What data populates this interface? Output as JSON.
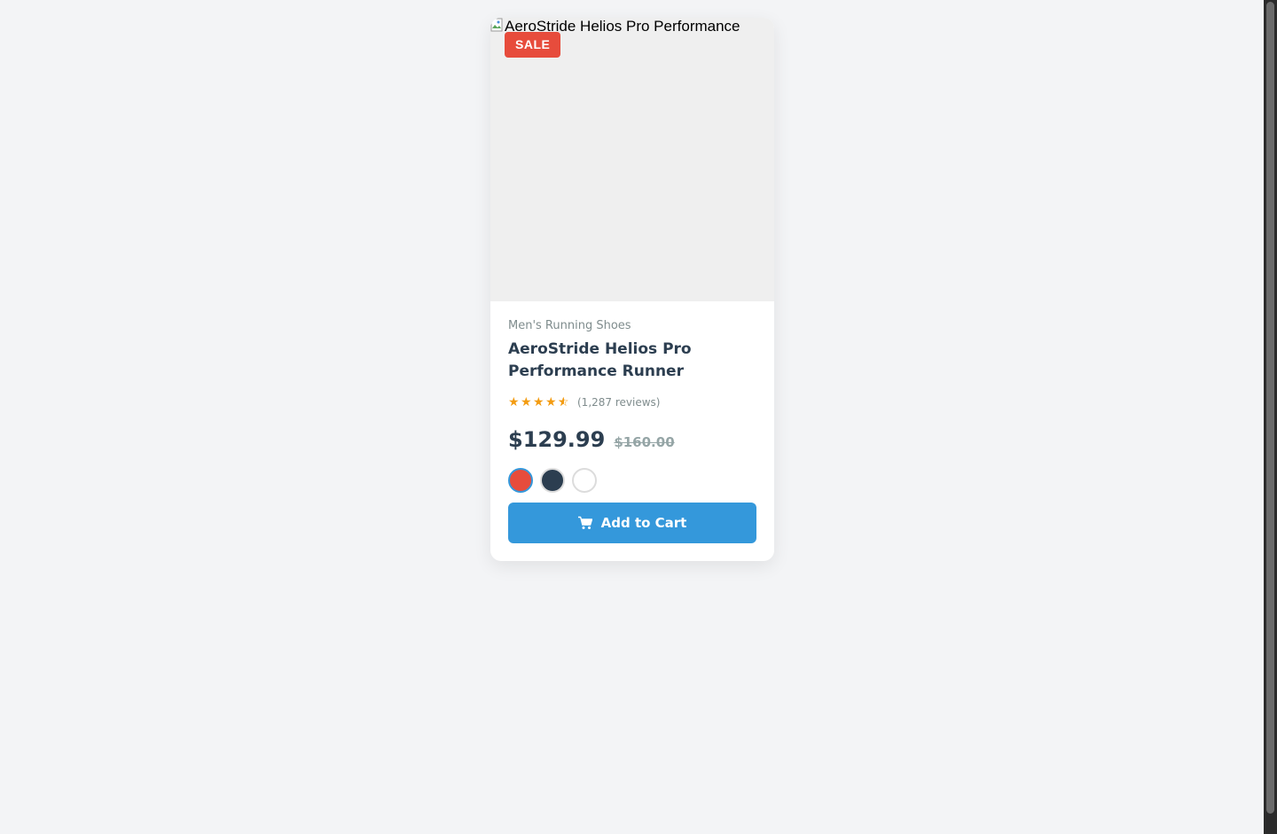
{
  "product": {
    "image_alt": "AeroStride Helios Pro Performance Runner",
    "badge": "SALE",
    "category": "Men's Running Shoes",
    "name": "AeroStride Helios Pro Performance Runner",
    "rating": 4.5,
    "rating_max": 5,
    "reviews": "(1,287 reviews)",
    "price": "$129.99",
    "old_price": "$160.00",
    "colors": [
      {
        "name": "red",
        "hex": "#e74c3c",
        "selected": true
      },
      {
        "name": "navy",
        "hex": "#2c3e50",
        "selected": false
      },
      {
        "name": "white",
        "hex": "#ffffff",
        "selected": false
      }
    ],
    "add_to_cart_label": "Add to Cart",
    "cart_icon": "cart-icon"
  },
  "colors": {
    "accent": "#3498db",
    "sale": "#e74c3c",
    "star": "#f39c12",
    "title": "#2c3e50"
  }
}
